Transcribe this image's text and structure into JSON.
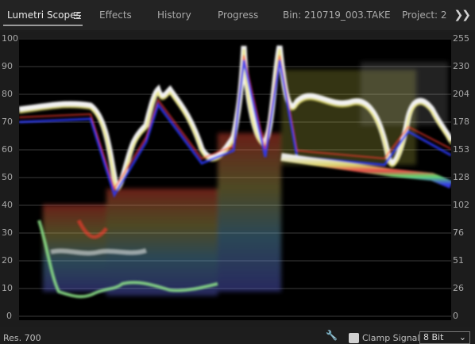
{
  "tabs": [
    {
      "label": "Lumetri Scopes",
      "active": true
    },
    {
      "label": "Effects"
    },
    {
      "label": "History"
    },
    {
      "label": "Progress"
    },
    {
      "label": "Bin: 210719_003.TAKE"
    },
    {
      "label": "Project: 2"
    }
  ],
  "icons": {
    "menu": "hamburger-menu-icon",
    "overflow": "double-chevron-right-icon"
  },
  "scope": {
    "type": "waveform-rgb",
    "left_axis": [
      "100",
      "90",
      "80",
      "70",
      "60",
      "50",
      "40",
      "30",
      "20",
      "10",
      "0"
    ],
    "right_axis": [
      "255",
      "230",
      "204",
      "178",
      "153",
      "128",
      "102",
      "76",
      "51",
      "26",
      "0"
    ]
  },
  "footer": {
    "res_label": "Res. 700",
    "clamp_label": "Clamp Signal",
    "clamp_checked": true,
    "bit_depth": "8 Bit"
  }
}
